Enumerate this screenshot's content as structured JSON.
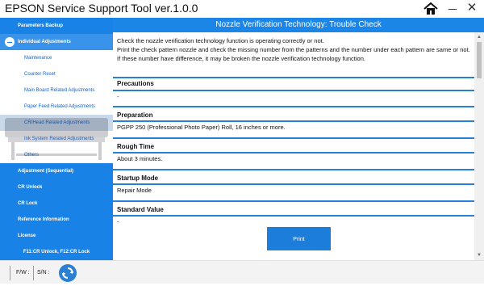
{
  "app": {
    "title": "EPSON Service Support Tool  ver.1.0.0"
  },
  "sidebar": {
    "parameters_backup": "Parameters Backup",
    "individual_adjustments": "Individual Adjustments",
    "sub_items": [
      "Maintenance",
      "Counter Reset",
      "Main Board Related Adjustments",
      "Paper Feed Related Adjustments",
      "CR/Head Related Adjustments",
      "Ink System Related Adjustments",
      "Others"
    ],
    "adjustment_sequential": "Adjustment (Sequential)",
    "cr_unlock": "CR Unlock",
    "cr_lock": "CR Lock",
    "reference_information": "Reference Information",
    "license": "License",
    "shortcut_hint": "F11:CR Unlock, F12:CR Lock"
  },
  "header": {
    "title": "Nozzle Verification Technology: Trouble Check"
  },
  "content": {
    "intro": [
      "Check the nozzle verification technology function is operating correctly or not.",
      "Print the check pattern nozzle and check the missing number from the patterns and the number under each pattern are same or not.",
      "If these number have difference, it may be broken the nozzle verification technology function."
    ],
    "sections": [
      {
        "title": "Precautions",
        "value": "-"
      },
      {
        "title": "Preparation",
        "value": "PGPP 250 (Professional Photo Paper) Roll, 16 inches or more."
      },
      {
        "title": "Rough Time",
        "value": "About 3 minutes."
      },
      {
        "title": "Startup Mode",
        "value": "Repair Mode"
      },
      {
        "title": "Standard Value",
        "value": "-"
      }
    ],
    "print_button": "Print"
  },
  "status": {
    "fw_label": "F/W :",
    "sn_label": "S/N :"
  },
  "colors": {
    "accent": "#1c86e8",
    "sidebar": "#0a6fd8",
    "divider": "#2a7fd6"
  }
}
